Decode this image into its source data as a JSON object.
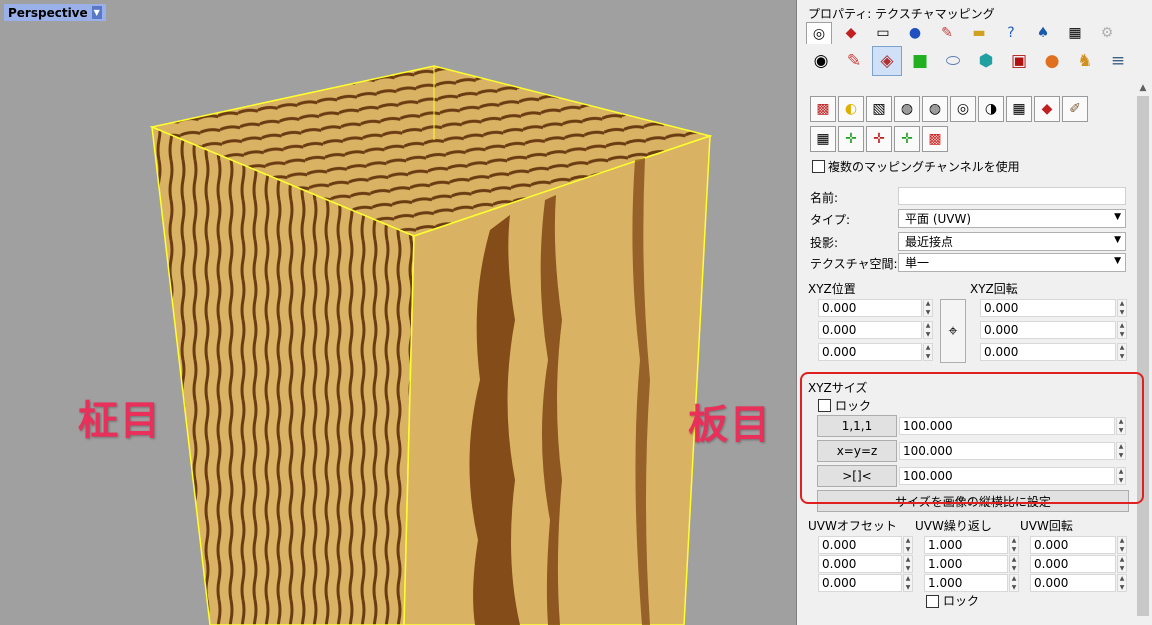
{
  "viewport": {
    "title": "Perspective",
    "label_left": "柾目",
    "label_right": "板目"
  },
  "panel": {
    "title": "プロパティ: テクスチャマッピング",
    "tabs": [
      "color-wheel-icon",
      "box-red-icon",
      "monitor-icon",
      "sphere-icon",
      "pen-icon",
      "folder-icon",
      "help-icon",
      "bell-icon",
      "checker-icon",
      "gear-icon"
    ],
    "icons_row": [
      "color-wheel-icon",
      "pencil-icon",
      "texture-mapping-icon",
      "green-square-icon",
      "cylinder-icon",
      "cube-icon",
      "red-box-icon",
      "orange-sphere-icon",
      "tiger-icon",
      "database-icon"
    ],
    "tools_row1": [
      "plane-map-icon",
      "duck-icon",
      "checker-box-icon",
      "checker-sphere-icon",
      "checker-sphere2-icon",
      "checker-cylinder-icon",
      "checker-cap-icon",
      "checker-shape-icon",
      "checker-pin-icon",
      "brush-icon"
    ],
    "tools_row2": [
      "checker-cube-icon",
      "axes-box-icon",
      "axes-plane-icon",
      "axes-green-icon",
      "red-checker-icon"
    ],
    "multi_channel_label": "複数のマッピングチャンネルを使用",
    "name_label": "名前:",
    "name_value": "",
    "type_label": "タイプ:",
    "type_value": "平面 (UVW)",
    "projection_label": "投影:",
    "projection_value": "最近接点",
    "texspace_label": "テクスチャ空間:",
    "texspace_value": "単一",
    "xyz_position_label": "XYZ位置",
    "xyz_rotation_label": "XYZ回転",
    "xyz_position": [
      "0.000",
      "0.000",
      "0.000"
    ],
    "xyz_rotation": [
      "0.000",
      "0.000",
      "0.000"
    ],
    "xyz_size_label": "XYZサイズ",
    "lock_label": "ロック",
    "btn_111": "1,1,1",
    "btn_xyz": "x=y=z",
    "btn_swap": ">[]<",
    "xyz_size": [
      "100.000",
      "100.000",
      "100.000"
    ],
    "set_size_btn": "サイズを画像の縦横比に設定",
    "uvw_offset_label": "UVWオフセット",
    "uvw_repeat_label": "UVW繰り返し",
    "uvw_rotation_label": "UVW回転",
    "uvw_offset": [
      "0.000",
      "0.000",
      "0.000"
    ],
    "uvw_repeat": [
      "1.000",
      "1.000",
      "1.000"
    ],
    "uvw_rotation": [
      "0.000",
      "0.000",
      "0.000"
    ],
    "lock_label2": "ロック"
  }
}
